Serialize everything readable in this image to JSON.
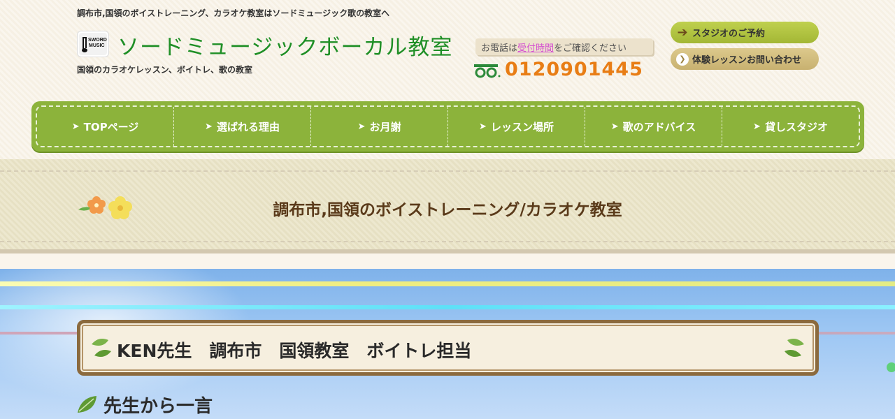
{
  "header": {
    "tagline": "調布市,国領のボイストレーニング、カラオケ教室はソードミュージック歌の教室へ",
    "logo_text": "SWORD MUSIC",
    "site_title": "ソードミュージックボーカル教室",
    "site_subtitle": "国領のカラオケレッスン、ボイトレ、歌の教室",
    "tel_note_prefix": "お電話は",
    "tel_note_link": "受付時間",
    "tel_note_suffix": "をご確認ください",
    "freedial_icon": "freedial-icon",
    "phone": "0120901445",
    "reserve_button": "スタジオのご予約",
    "trial_button": "体験レッスンお問い合わせ"
  },
  "nav": {
    "items": [
      {
        "label": "TOPページ"
      },
      {
        "label": "選ばれる理由"
      },
      {
        "label": "お月謝"
      },
      {
        "label": "レッスン場所"
      },
      {
        "label": "歌のアドバイス"
      },
      {
        "label": "貸しスタジオ"
      }
    ],
    "arrow": "➤"
  },
  "page": {
    "title": "調布市,国領のボイストレーニング/カラオケ教室"
  },
  "teacher": {
    "heading": "KEN先生　調布市　国領教室　ボイトレ担当",
    "message_heading": "先生から一言"
  },
  "colors": {
    "title_green": "#1f8f26",
    "phone_orange": "#e87d15",
    "nav_green": "#8cb33b",
    "link_pink": "#d44fd0",
    "heading_brown": "#5a3a1a"
  }
}
